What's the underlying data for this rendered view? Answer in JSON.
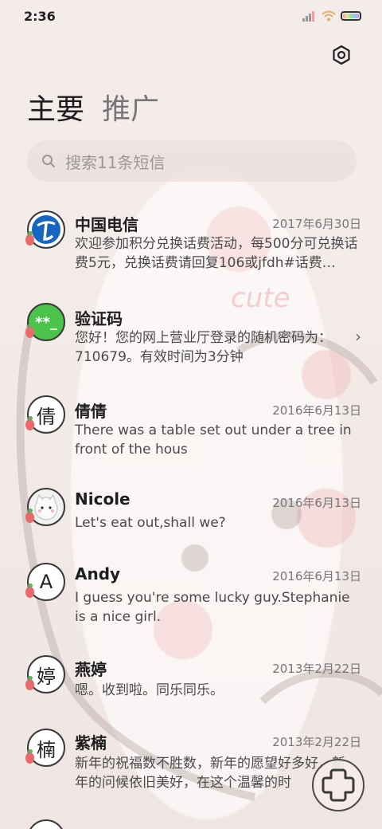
{
  "status_bar": {
    "time": "2:36"
  },
  "tabs": [
    {
      "label": "主要"
    },
    {
      "label": "推广"
    }
  ],
  "search": {
    "placeholder": "搜索11条短信"
  },
  "threads": [
    {
      "name": "中国电信",
      "date": "2017年6月30日",
      "preview": "欢迎参加积分兑换话费活动，每500分可兑换话费5元，兑换话费请回复106或jfdh#话费…",
      "avatar": "telecom-logo"
    },
    {
      "name": "验证码",
      "date": "",
      "preview": "您好！您的网上营业厅登录的随机密码为：710679。有效时间为3分钟",
      "avatar_text": "**_"
    },
    {
      "name": "倩倩",
      "date": "2016年6月13日",
      "preview": "There was a table set out under a tree in front of the hous",
      "avatar_text": "倩"
    },
    {
      "name": "Nicole",
      "date": "2016年6月13日",
      "preview": "Let's eat out,shall we?",
      "avatar": "cat-photo"
    },
    {
      "name": "Andy",
      "date": "2016年6月13日",
      "preview": "I guess you're some lucky guy.Stephanie is a nice girl.",
      "avatar_text": "A"
    },
    {
      "name": "燕婷",
      "date": "2013年2月22日",
      "preview": "嗯。收到啦。同乐同乐。",
      "avatar_text": "婷"
    },
    {
      "name": "紫楠",
      "date": "2013年2月22日",
      "preview": "新年的祝福数不胜数，新年的愿望好多好，新年的问候依旧美好，在这个温馨的时",
      "avatar_text": "楠"
    }
  ],
  "icons": {
    "settings": "gear-icon",
    "search": "search-icon",
    "compose": "compose-plus-icon",
    "chevron": "chevron-right-icon"
  },
  "colors": {
    "verify_avatar": "#4cc44c",
    "telecom_blue": "#1466c0",
    "accent_red": "#e86a6a"
  }
}
